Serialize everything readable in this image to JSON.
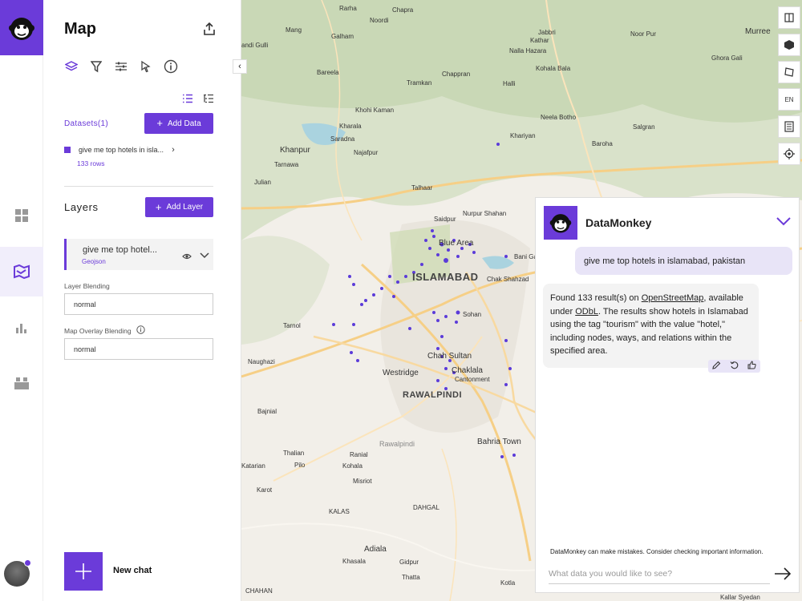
{
  "panel": {
    "title": "Map",
    "datasets_label": "Datasets(1)",
    "add_data": "Add Data",
    "dataset": {
      "name": "give me top hotels in isla...",
      "rows": "133 rows"
    },
    "layers_title": "Layers",
    "add_layer": "Add Layer",
    "layer": {
      "name": "give me top hotel...",
      "type": "Geojson"
    },
    "layer_blending_label": "Layer Blending",
    "layer_blending_value": "normal",
    "overlay_blending_label": "Map Overlay Blending",
    "overlay_blending_value": "normal",
    "new_chat": "New chat"
  },
  "map": {
    "controls": {
      "lang": "EN"
    },
    "places": {
      "rarha": "Rarha",
      "chapra": "Chapra",
      "noordi": "Noordi",
      "jabbri": "Jabbri",
      "noorpur": "Noor Pur",
      "murree": "Murree",
      "mang": "Mang",
      "galham": "Galham",
      "kathar": "Kathar",
      "nalla_hazara": "Nalla Hazara",
      "ghora_gali": "Ghora Gali",
      "gulli": "andi Gulli",
      "bareela": "Bareela",
      "chappran": "Chappran",
      "kohala_bala": "Kohala Bala",
      "tramkan": "Tramkan",
      "halli": "Halli",
      "khohi_kaman": "Khohi Kaman",
      "neela_botho": "Neela Botho",
      "kharala": "Kharala",
      "salgran": "Salgran",
      "saradna": "Saradna",
      "khariyan": "Khariyan",
      "baroha": "Baroha",
      "khanpur": "Khanpur",
      "najafpur": "Najafpur",
      "tarnawa": "Tarnawa",
      "julian": "Julian",
      "talhaar": "Talhaar",
      "saidpur": "Saidpur",
      "nurpur_shahan": "Nurpur Shahan",
      "blue_area": "Blue Area",
      "bani_ga": "Bani Ga",
      "islamabad": "ISLAMABAD",
      "chak_shahzad": "Chak Shahzad",
      "sohan": "Sohan",
      "tarnol": "Tarnol",
      "naughazi": "Naughazi",
      "chah_sultan": "Chah Sultan",
      "chaklala": "Chaklala",
      "westridge": "Westridge",
      "cantonment": "Cantonment",
      "rawalpindi_caps": "RAWALPINDI",
      "bajnial": "Bajnial",
      "bahria_town": "Bahria Town",
      "rawalpindi": "Rawalpindi",
      "thalian": "Thalian",
      "ranial": "Ranial",
      "katarian": "Katarian",
      "pilo": "Pilo",
      "kohala": "Kohala",
      "misriot": "Misriot",
      "karot": "Karot",
      "dahgal": "DAHGAL",
      "kalas": "KALAS",
      "adiala": "Adiala",
      "khasala": "Khasala",
      "gidpur": "Gidpur",
      "thatta": "Thatta",
      "kotla": "Kotla",
      "chahan": "CHAHAN",
      "kallar_syedan": "Kallar Syedan"
    }
  },
  "chat": {
    "title": "DataMonkey",
    "user_message": "give me top hotels in islamabad, pakistan",
    "bot_message": {
      "p1": "Found 133 result(s) on ",
      "link1": "OpenStreetMap",
      "p2": ", available under ",
      "link2": "ODbL",
      "p3": ". The results show hotels in Islamabad using the tag \"tourism\" with the value \"hotel,\" including nodes, ways, and relations within the specified area."
    },
    "disclaimer": "DataMonkey can make mistakes. Consider checking important information.",
    "input_placeholder": "What data you would like to see?"
  },
  "colors": {
    "accent": "#6b3bd9",
    "map_bg": "#f2efe9",
    "point": "#5b3bd9"
  }
}
